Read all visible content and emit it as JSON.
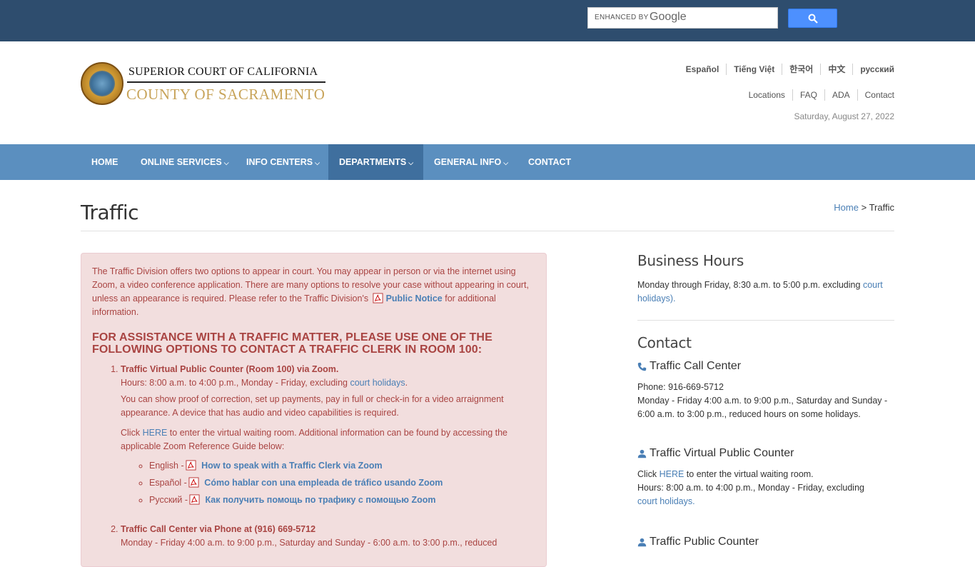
{
  "search": {
    "enhanced_label": "ENHANCED BY",
    "brand": "Google"
  },
  "header": {
    "title": "SUPERIOR COURT OF CALIFORNIA",
    "county": "COUNTY OF SACRAMENTO",
    "languages": [
      "Español",
      "Tiếng Việt",
      "한국어",
      "中文",
      "русский"
    ],
    "utility": [
      "Locations",
      "FAQ",
      "ADA",
      "Contact"
    ],
    "date": "Saturday, August 27, 2022"
  },
  "nav": {
    "items": [
      "HOME",
      "ONLINE SERVICES",
      "INFO CENTERS",
      "DEPARTMENTS",
      "GENERAL INFO",
      "CONTACT"
    ],
    "active": "DEPARTMENTS"
  },
  "page": {
    "title": "Traffic",
    "breadcrumb_home": "Home",
    "breadcrumb_sep": ">",
    "breadcrumb_current": "Traffic"
  },
  "alert": {
    "intro": "The Traffic Division offers two options to appear in court. You may appear in person or via the internet using Zoom, a video conference application. There are many options to resolve your case without appearing in court, unless an appearance is required. Please refer to the Traffic Division's",
    "intro_link": "Public Notice",
    "intro_tail": "for additional information.",
    "heading": "FOR ASSISTANCE WITH A TRAFFIC MATTER, PLEASE USE ONE OF THE FOLLOWING OPTIONS TO CONTACT A TRAFFIC CLERK IN ROOM 100:",
    "opt1_lead": "Traffic Virtual Public Counter (Room 100) via Zoom.",
    "opt1_hours": "Hours: 8:00 a.m. to 4:00 p.m., Monday - Friday, excluding",
    "opt1_hours_link": "court holidays",
    "opt1_hours_tail": ".",
    "opt1_desc": "You can show proof of correction, set up payments, pay in full or check-in for a video arraignment appearance. A device that has audio and video capabilities is required.",
    "opt1_click": "Click",
    "opt1_here": "HERE",
    "opt1_click_tail": "to enter the virtual waiting room. Additional information can be found by accessing the applicable Zoom Reference Guide below:",
    "guides": [
      {
        "lang": "English -",
        "link": "How to speak with a Traffic Clerk via Zoom"
      },
      {
        "lang": "Español -",
        "link": "Cómo hablar con una empleada de tráfico usando Zoom"
      },
      {
        "lang": "Русский -",
        "link": "Как получить помощь по трафику с помощью Zoom"
      }
    ],
    "opt2_lead": "Traffic Call Center via Phone at (916) 669-5712",
    "opt2_text": "Monday - Friday 4:00 a.m. to 9:00 p.m., Saturday and Sunday - 6:00 a.m. to 3:00 p.m., reduced"
  },
  "sidebar": {
    "hours_heading": "Business Hours",
    "hours_text": "Monday through Friday, 8:30 a.m. to 5:00 p.m. excluding",
    "hours_link": "court holidays",
    "hours_tail": ").",
    "contact_heading": "Contact",
    "call_center_title": "Traffic Call Center",
    "call_center_phone": "Phone: 916-669-5712",
    "call_center_hours": "Monday - Friday 4:00 a.m. to 9:00 p.m., Saturday and Sunday - 6:00 a.m. to 3:00 p.m., reduced hours on some holidays.",
    "vpc_title": "Traffic Virtual Public Counter",
    "vpc_click": "Click",
    "vpc_here": "HERE",
    "vpc_click_tail": "to enter the virtual waiting room.",
    "vpc_hours": "Hours: 8:00 a.m. to 4:00 p.m., Monday - Friday, excluding",
    "vpc_hours_link": "court holidays",
    "vpc_hours_tail": ".",
    "pc_title": "Traffic Public Counter"
  },
  "colors": {
    "topbar": "#2e4d6e",
    "nav": "#5b8fbf",
    "nav_active": "#3f6f9e",
    "alert_bg": "#f2dede",
    "alert_text": "#a94442",
    "link": "#4a7fb5",
    "county_gold": "#c8a45a"
  }
}
